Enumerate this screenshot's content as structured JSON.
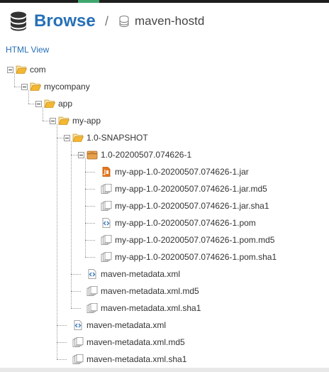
{
  "header": {
    "title": "Browse",
    "separator": "/",
    "repository": "maven-hostd"
  },
  "links": {
    "html_view": "HTML View"
  },
  "tree": [
    {
      "label": "com",
      "icon": "folder-open-icon",
      "level": 0
    },
    {
      "label": "mycompany",
      "icon": "folder-open-icon",
      "level": 1
    },
    {
      "label": "app",
      "icon": "folder-open-icon",
      "level": 2
    },
    {
      "label": "my-app",
      "icon": "folder-open-icon",
      "level": 3
    },
    {
      "label": "1.0-SNAPSHOT",
      "icon": "folder-open-icon",
      "level": 4
    },
    {
      "label": "1.0-20200507.074626-1",
      "icon": "package-icon",
      "level": 5
    },
    {
      "label": "my-app-1.0-20200507.074626-1.jar",
      "icon": "jar-file-icon",
      "level": 6
    },
    {
      "label": "my-app-1.0-20200507.074626-1.jar.md5",
      "icon": "generic-file-icon",
      "level": 6
    },
    {
      "label": "my-app-1.0-20200507.074626-1.jar.sha1",
      "icon": "generic-file-icon",
      "level": 6
    },
    {
      "label": "my-app-1.0-20200507.074626-1.pom",
      "icon": "xml-file-icon",
      "level": 6
    },
    {
      "label": "my-app-1.0-20200507.074626-1.pom.md5",
      "icon": "generic-file-icon",
      "level": 6
    },
    {
      "label": "my-app-1.0-20200507.074626-1.pom.sha1",
      "icon": "generic-file-icon",
      "level": 6
    },
    {
      "label": "maven-metadata.xml",
      "icon": "xml-file-icon",
      "level": 5
    },
    {
      "label": "maven-metadata.xml.md5",
      "icon": "generic-file-icon",
      "level": 5
    },
    {
      "label": "maven-metadata.xml.sha1",
      "icon": "generic-file-icon",
      "level": 5
    },
    {
      "label": "maven-metadata.xml",
      "icon": "xml-file-icon",
      "level": 4
    },
    {
      "label": "maven-metadata.xml.md5",
      "icon": "generic-file-icon",
      "level": 4
    },
    {
      "label": "maven-metadata.xml.sha1",
      "icon": "generic-file-icon",
      "level": 4
    }
  ],
  "colors": {
    "accent": "#2670b7",
    "folder": "#f5b730",
    "package": "#e8a14a",
    "jar": "#e8751a",
    "xml": "#3b7dc4"
  }
}
